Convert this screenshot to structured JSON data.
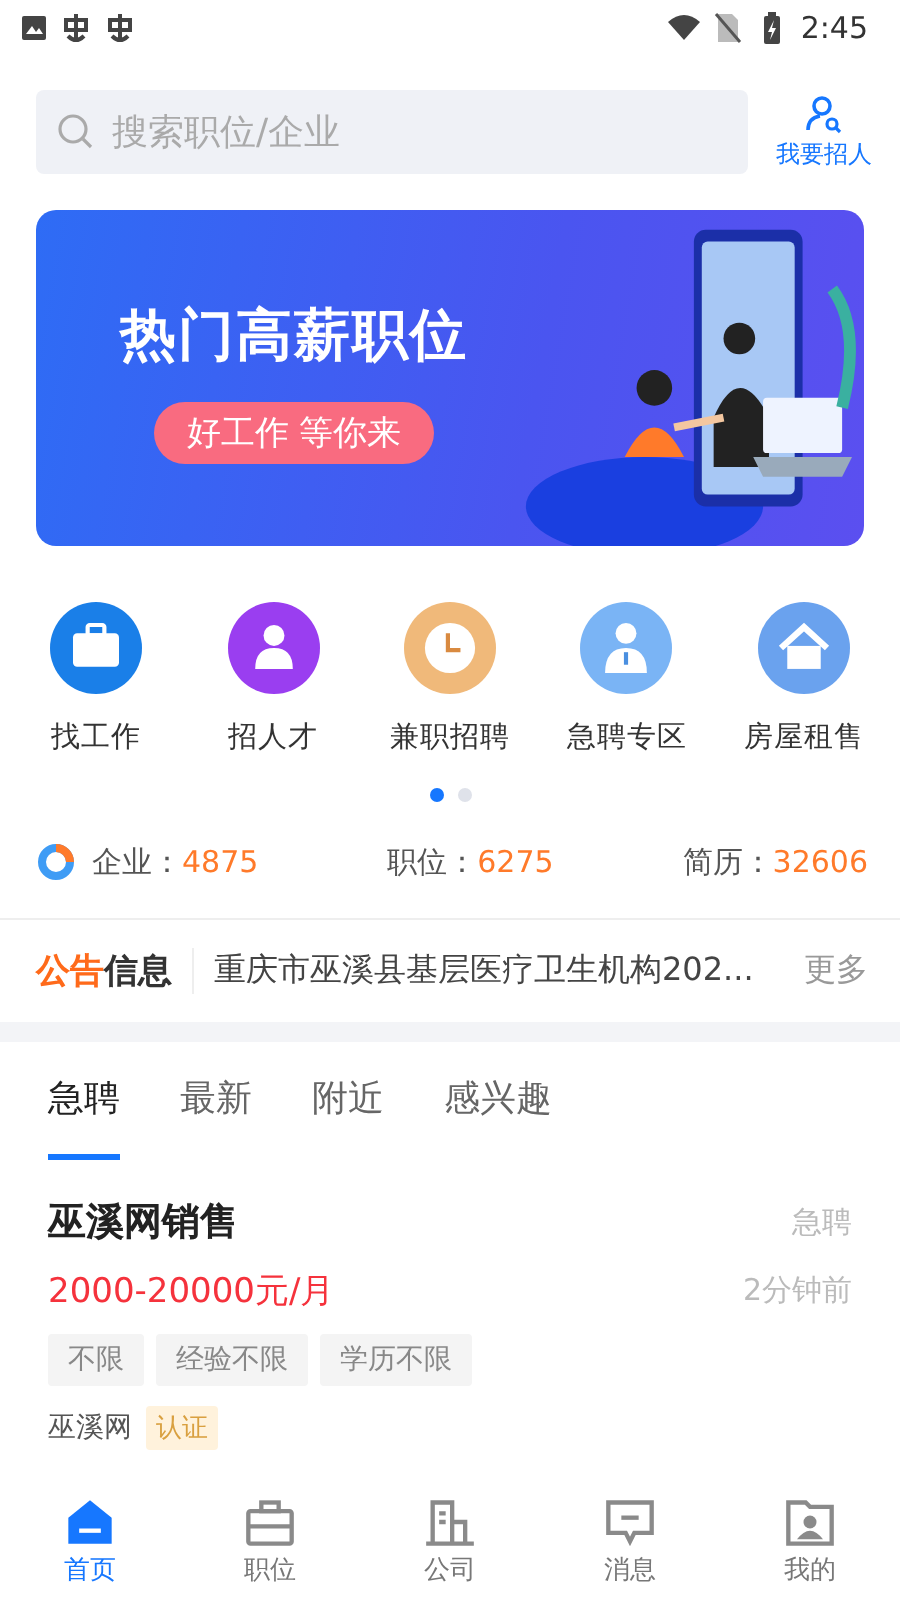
{
  "status_bar": {
    "time": "2:45"
  },
  "search": {
    "placeholder": "搜索职位/企业"
  },
  "recruit_button": {
    "label": "我要招人"
  },
  "banner": {
    "title": "热门高薪职位",
    "slogan": "好工作 等你来"
  },
  "shortcuts": [
    {
      "label": "找工作",
      "kind": "briefcase",
      "color": "#1a7fe8"
    },
    {
      "label": "招人才",
      "kind": "person",
      "color": "#9a3ef0"
    },
    {
      "label": "兼职招聘",
      "kind": "clock",
      "color": "#f0b97a"
    },
    {
      "label": "急聘专区",
      "kind": "badge",
      "color": "#7ab4f5"
    },
    {
      "label": "房屋租售",
      "kind": "house",
      "color": "#6aa2ee"
    }
  ],
  "pager": [
    {
      "selected": true
    },
    {
      "selected": false
    }
  ],
  "stats": [
    {
      "label": "企业：",
      "value": "4875"
    },
    {
      "label": "职位：",
      "value": "6275"
    },
    {
      "label": "简历：",
      "value": "32606"
    }
  ],
  "notice": {
    "logo_accent": "公告",
    "logo_rest": "信息",
    "text": "重庆市巫溪县基层医疗卫生机构202...",
    "more": "更多"
  },
  "tabs": [
    {
      "label": "急聘",
      "selected": true
    },
    {
      "label": "最新",
      "selected": false
    },
    {
      "label": "附近",
      "selected": false
    },
    {
      "label": "感兴趣",
      "selected": false
    }
  ],
  "jobs": [
    {
      "title": "巫溪网销售",
      "flag": "急聘",
      "salary": "2000-20000元/月",
      "time": "2分钟前",
      "tags": [
        "不限",
        "经验不限",
        "学历不限"
      ],
      "company": "巫溪网",
      "verified": "认证"
    }
  ],
  "nav": [
    {
      "label": "首页",
      "kind": "home",
      "selected": true
    },
    {
      "label": "职位",
      "kind": "briefcase",
      "selected": false
    },
    {
      "label": "公司",
      "kind": "building",
      "selected": false
    },
    {
      "label": "消息",
      "kind": "message",
      "selected": false
    },
    {
      "label": "我的",
      "kind": "profile",
      "selected": false
    }
  ]
}
